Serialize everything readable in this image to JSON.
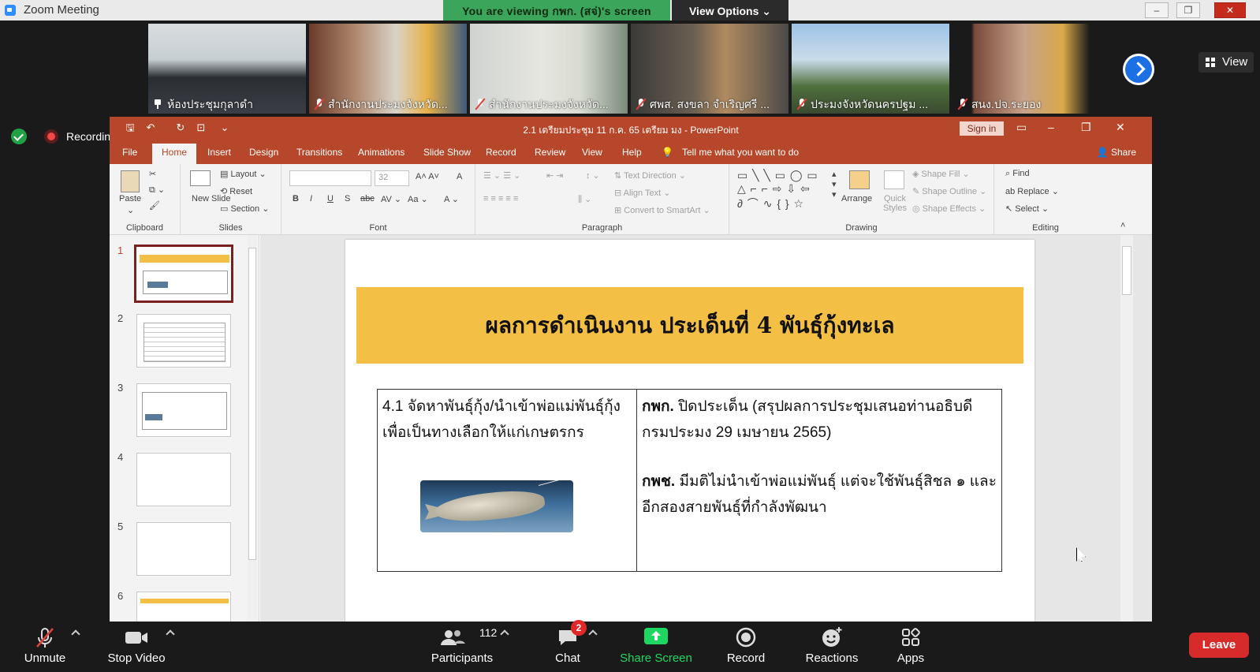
{
  "window": {
    "app_name": "Zoom Meeting"
  },
  "banner": {
    "viewing": "You are viewing กพก. (สจ่)'s screen",
    "view_options": "View Options"
  },
  "strip": {
    "participants": [
      {
        "name": "ห้องประชุมกุลาดำ",
        "mic": "pinned"
      },
      {
        "name": "สำนักงานประมงจังหวัด...",
        "mic": "muted"
      },
      {
        "name": "สำนักงานประมงจังหวัด...",
        "mic": "muted"
      },
      {
        "name": "ศพส. สงขลา จำเริญศรี ...",
        "mic": "muted"
      },
      {
        "name": "ประมงจังหวัดนครปฐม ...",
        "mic": "muted"
      },
      {
        "name": "สนง.ปจ.ระยอง",
        "mic": "muted"
      }
    ],
    "view_label": "View"
  },
  "recording": {
    "label": "Recording"
  },
  "ppt": {
    "title": "2.1 เตรียมประชุม 11 ก.ค. 65 เตรียม มง  -  PowerPoint",
    "sign_in": "Sign in",
    "tabs": [
      "File",
      "Home",
      "Insert",
      "Design",
      "Transitions",
      "Animations",
      "Slide Show",
      "Record",
      "Review",
      "View",
      "Help"
    ],
    "tell_me": "Tell me what you want to do",
    "share": "Share",
    "ribbon": {
      "clipboard": {
        "label": "Clipboard",
        "paste": "Paste"
      },
      "slides": {
        "label": "Slides",
        "new_slide": "New Slide",
        "layout": "Layout",
        "reset": "Reset",
        "section": "Section"
      },
      "font": {
        "label": "Font",
        "size": "32"
      },
      "paragraph": {
        "label": "Paragraph",
        "text_direction": "Text Direction",
        "align_text": "Align Text",
        "convert": "Convert to SmartArt"
      },
      "drawing": {
        "label": "Drawing",
        "arrange": "Arrange",
        "quick_styles": "Quick Styles",
        "shape_fill": "Shape Fill",
        "shape_outline": "Shape Outline",
        "shape_effects": "Shape Effects"
      },
      "editing": {
        "label": "Editing",
        "find": "Find",
        "replace": "Replace",
        "select": "Select"
      }
    },
    "thumbnails": [
      "1",
      "2",
      "3",
      "4",
      "5",
      "6"
    ],
    "slide": {
      "title": "ผลการดำเนินงาน ประเด็นที่ 4 พันธุ์กุ้งทะเล",
      "left_cell": "4.1 จัดหาพันธุ์กุ้ง/นำเข้าพ่อแม่พันธุ์กุ้ง เพื่อเป็นทางเลือกให้แก่เกษตรกร",
      "right_1_bold": "กพก.",
      "right_1_text": " ปิดประเด็น (สรุปผลการประชุมเสนอท่านอธิบดี กรมประมง 29 เมษายน 2565)",
      "right_2_bold": "กพช.",
      "right_2_text": " มีมติไม่นำเข้าพ่อแม่พันธุ์ แต่จะใช้พันธุ์สิชล ๑ และอีกสองสายพันธุ์ที่กำลังพัฒนา"
    }
  },
  "bottom_bar": {
    "unmute": "Unmute",
    "stop_video": "Stop Video",
    "participants": "Participants",
    "participant_count": "112",
    "chat": "Chat",
    "chat_badge": "2",
    "share_screen": "Share Screen",
    "record": "Record",
    "reactions": "Reactions",
    "apps": "Apps",
    "leave": "Leave"
  }
}
